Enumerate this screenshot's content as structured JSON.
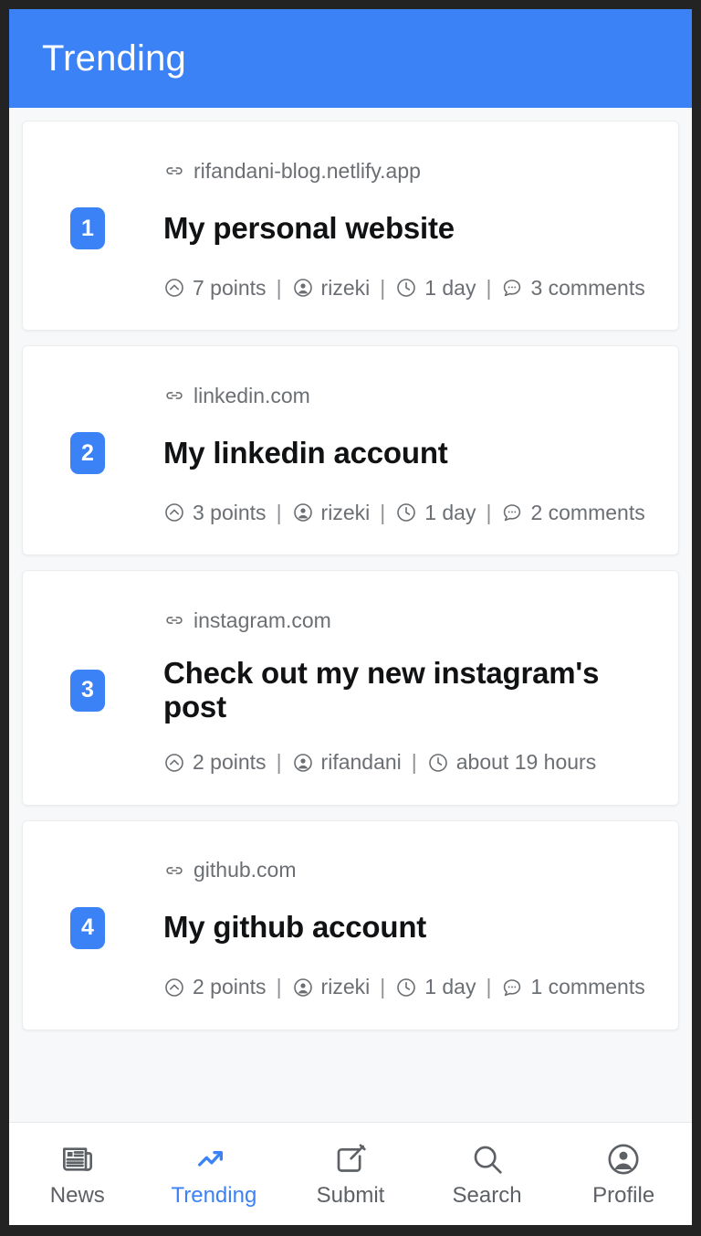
{
  "header": {
    "title": "Trending"
  },
  "stories": [
    {
      "rank": "1",
      "domain": "rifandani-blog.netlify.app",
      "title": "My personal website",
      "points": "7 points",
      "author": "rizeki",
      "time": "1 day",
      "comments": "3 comments"
    },
    {
      "rank": "2",
      "domain": "linkedin.com",
      "title": "My linkedin account",
      "points": "3 points",
      "author": "rizeki",
      "time": "1 day",
      "comments": "2 comments"
    },
    {
      "rank": "3",
      "domain": "instagram.com",
      "title": "Check out my new instagram's post",
      "points": "2 points",
      "author": "rifandani",
      "time": "about 19 hours",
      "comments": ""
    },
    {
      "rank": "4",
      "domain": "github.com",
      "title": "My github account",
      "points": "2 points",
      "author": "rizeki",
      "time": "1 day",
      "comments": "1 comments"
    }
  ],
  "separator": "|",
  "tabs": [
    {
      "label": "News",
      "icon": "newspaper-icon",
      "active": false
    },
    {
      "label": "Trending",
      "icon": "trending-up-icon",
      "active": true
    },
    {
      "label": "Submit",
      "icon": "compose-icon",
      "active": false
    },
    {
      "label": "Search",
      "icon": "search-icon",
      "active": false
    },
    {
      "label": "Profile",
      "icon": "profile-icon",
      "active": false
    }
  ],
  "colors": {
    "accent": "#3b82f6",
    "header_text": "#ffffff",
    "page_bg": "#f7f8f9",
    "card_bg": "#ffffff",
    "title_text": "#111214",
    "meta_text": "#6b6f73",
    "bezel": "#232323"
  }
}
